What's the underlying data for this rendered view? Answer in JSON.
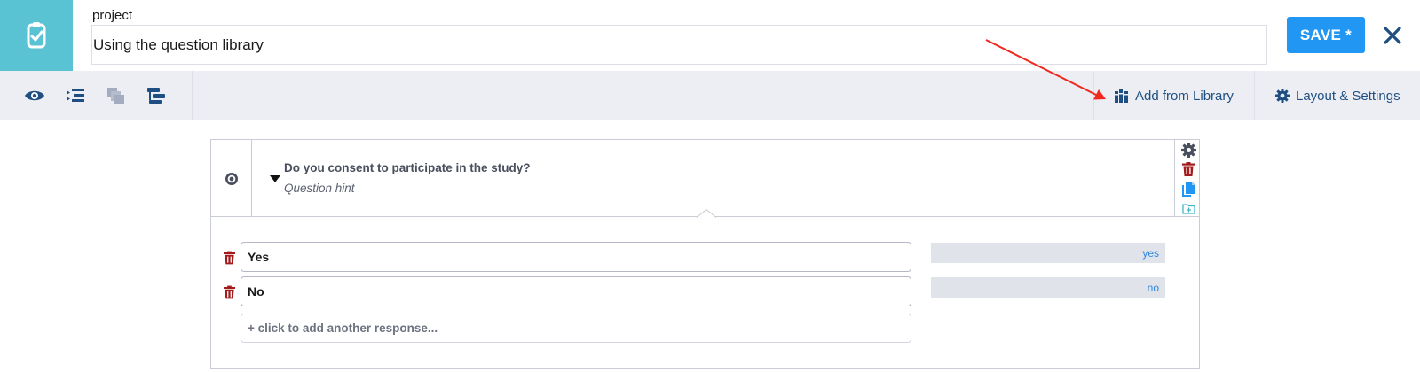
{
  "header": {
    "title_label": "project",
    "title_value": "Using the question library",
    "save_label": "SAVE *",
    "close_icon": "close-icon",
    "logo_icon": "clipboard-check-icon"
  },
  "toolbar": {
    "tools": [
      "preview-eye-icon",
      "indent-list-icon",
      "copy-stack-icon",
      "flow-logic-icon"
    ],
    "add_library_label": "Add from Library",
    "layout_settings_label": "Layout & Settings"
  },
  "question": {
    "type_icon": "radio-select-one-icon",
    "label": "Do you consent to participate in the study?",
    "hint": "Question hint",
    "responses": [
      {
        "label": "Yes",
        "value": "yes"
      },
      {
        "label": "No",
        "value": "no"
      }
    ],
    "add_response_label": "+ click to add another response..."
  },
  "colors": {
    "brand": "#59c2d3",
    "primary": "#2196f3",
    "toolbar_bg": "#eceef3",
    "icon_dark": "#1f4f82",
    "delete": "#a31b1b",
    "value_text": "#2f86de",
    "annotation_arrow": "#f0281e"
  }
}
